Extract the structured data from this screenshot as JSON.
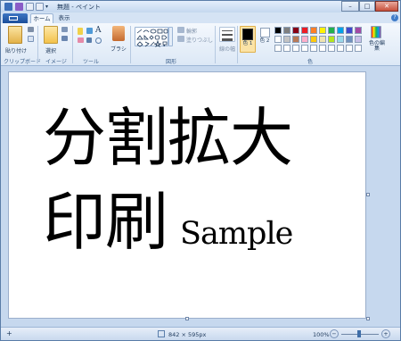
{
  "window": {
    "title": "無題 - ペイント",
    "minimize": "–",
    "maximize": "□",
    "close": "✕"
  },
  "tabs": {
    "home": "ホーム",
    "view": "表示"
  },
  "ribbon": {
    "paste_label": "貼り付け",
    "select_label": "選択",
    "brush_label": "ブラシ",
    "outline_label": "輪郭",
    "fill_label": "塗りつぶし",
    "size_label": "線の幅",
    "color1_label": "色 1",
    "color2_label": "色 2",
    "edit_colors_label": "色の編集",
    "groups": {
      "clipboard": "クリップボード",
      "image": "イメージ",
      "tools": "ツール",
      "shapes": "図形",
      "colors": "色"
    },
    "palette_row1": [
      "#000000",
      "#7f7f7f",
      "#880015",
      "#ed1c24",
      "#ff7f27",
      "#fff200",
      "#22b14c",
      "#00a2e8",
      "#3f48cc",
      "#a349a4"
    ],
    "palette_row2": [
      "#ffffff",
      "#c3c3c3",
      "#b97a57",
      "#ffaec9",
      "#ffc90e",
      "#efe4b0",
      "#b5e61d",
      "#99d9ea",
      "#7092be",
      "#c8bfe7"
    ],
    "palette_row3": [
      "#ffffff",
      "#ffffff",
      "#ffffff",
      "#ffffff",
      "#ffffff",
      "#ffffff",
      "#ffffff",
      "#ffffff",
      "#ffffff",
      "#ffffff"
    ]
  },
  "canvas": {
    "line1": "分割拡大",
    "line2_kanji": "印刷",
    "line2_sample": "Sample"
  },
  "status": {
    "dimensions": "842 × 595px",
    "zoom": "100%",
    "zoom_out": "−",
    "zoom_in": "+"
  }
}
